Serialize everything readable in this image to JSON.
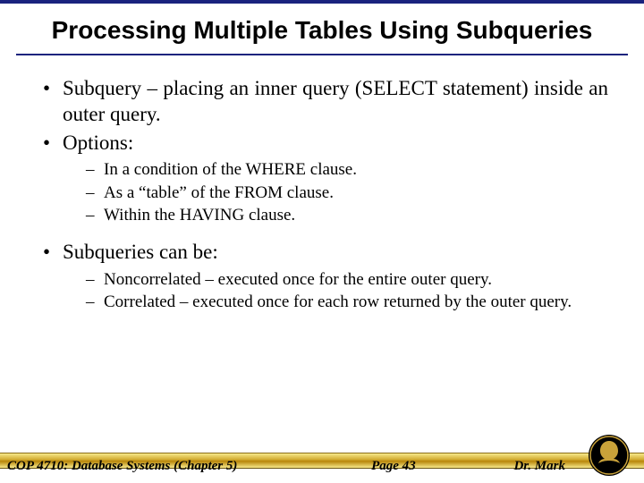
{
  "title": "Processing Multiple Tables Using Subqueries",
  "bullets": {
    "b1": "Subquery – placing an inner query (SELECT statement) inside an outer query.",
    "b2": "Options:",
    "b2_subs": {
      "s1": "In a condition of the WHERE clause.",
      "s2": "As a “table” of the FROM clause.",
      "s3": "Within the HAVING clause."
    },
    "b3": "Subqueries can be:",
    "b3_subs": {
      "s1": "Noncorrelated – executed once for the entire outer query.",
      "s2": "Correlated – executed once for each row returned by the outer query."
    }
  },
  "footer": {
    "left": "COP 4710: Database Systems (Chapter 5)",
    "center": "Page 43",
    "right": "Dr. Mark"
  }
}
